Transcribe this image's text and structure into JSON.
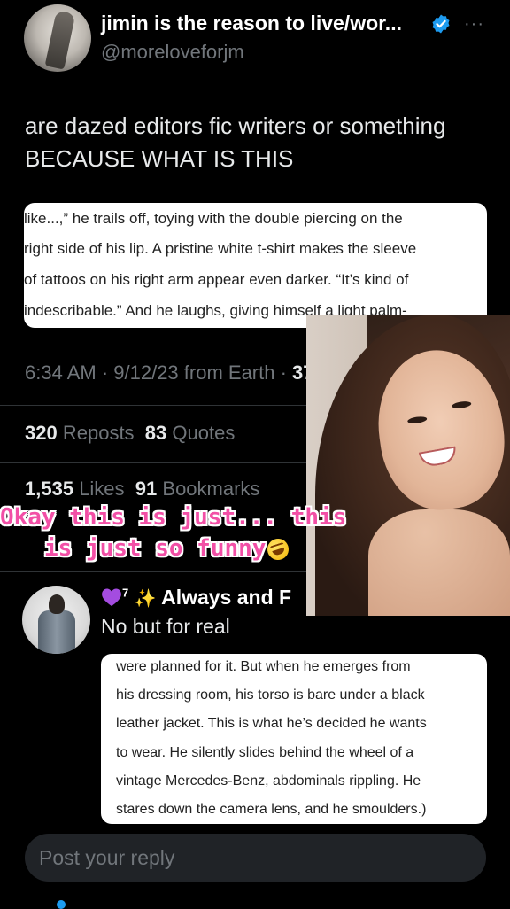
{
  "tweet": {
    "author_name": "jimin is the reason to live/wor...",
    "handle": "@moreloveforjm",
    "text_lines": [
      "are dazed editors fic writers or something",
      "BECAUSE WHAT IS THIS"
    ],
    "excerpt_lines": [
      "like...,” he trails off, toying with the double piercing on the",
      "right side of his lip. A pristine white t-shirt makes the sleeve",
      "of tattoos on his right arm appear even darker. “It’s kind of",
      "indescribable.” And he laughs, giving himself a light palm-"
    ],
    "timestamp": "6:34 AM · 9/12/23 from Earth · ",
    "views": "37.4K",
    "reposts_count": "320",
    "reposts_label": "Reposts",
    "quotes_count": "83",
    "quotes_label": "Quotes",
    "likes_count": "1,535",
    "likes_label": "Likes",
    "bookmarks_count": "91",
    "bookmarks_label": "Bookmarks"
  },
  "overlay": {
    "caption_line1": "Okay this is just... this",
    "caption_line2": "is just so funny",
    "caption_emoji": "rolling-on-floor-laughing-icon"
  },
  "reply": {
    "author_name_suffix": "7",
    "author_name": "Always and F",
    "text": "No but for real",
    "excerpt_lines": [
      "were planned for it. But when he emerges from",
      "his dressing room, his torso is bare under a black",
      "leather jacket. This is what he’s decided he wants",
      "to wear. He silently slides behind the wheel of a",
      "vintage Mercedes-Benz, abdominals rippling. He",
      "stares down the camera lens, and he smoulders.)"
    ]
  },
  "composer": {
    "placeholder": "Post your reply"
  },
  "colors": {
    "background": "#000000",
    "text_primary": "#e7e9ea",
    "text_secondary": "#71767b",
    "verified": "#1d9bf0",
    "caption_pink": "#f24fa6",
    "heart_purple": "#a44ce0"
  }
}
